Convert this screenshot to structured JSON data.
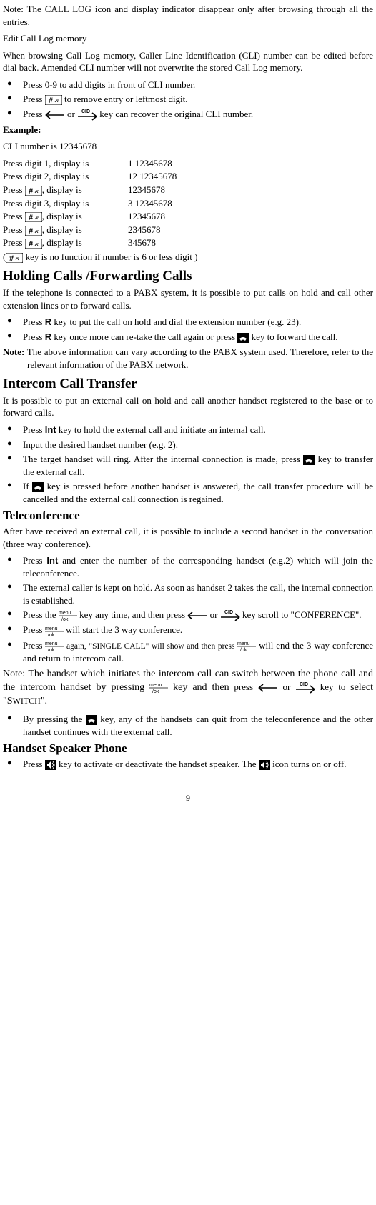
{
  "note1": "Note: The CALL LOG icon and display indicator disappear only after browsing through all the entries.",
  "editTitle": "Edit Call Log memory",
  "editPara": "When browsing Call Log memory, Caller Line Identification (CLI) number can be edited before dial back. Amended CLI number will not overwrite the stored Call Log memory.",
  "b1": "Press 0-9 to add digits in front of CLI number.",
  "b2a": "Press ",
  "b2b": " to remove entry or leftmost digit.",
  "b3a": "Press ",
  "b3b": " or ",
  "b3c": " key can recover the original CLI number.",
  "example": "Example:",
  "cliNum": "CLI number is 12345678",
  "rows": [
    {
      "l": "Press digit 1, display is",
      "r": "  1 12345678"
    },
    {
      "l": "Press digit 2, display is",
      "r": "  12 12345678"
    },
    {
      "l": "",
      "r": "   12345678"
    },
    {
      "l": "Press digit 3, display is",
      "r": "    3 12345678"
    },
    {
      "l": "",
      "r": "   12345678"
    },
    {
      "l": "",
      "r": "  2345678"
    },
    {
      "l": "",
      "r": "  345678"
    }
  ],
  "pressHash": "Press ",
  "pressHashTail": ",    display is",
  "paren1a": "(",
  "paren1b": " key is no function if number is 6 or less digit )",
  "h_holding": "Holding Calls /Forwarding Calls",
  "holdingP": "If the telephone is connected to a PABX system, it is possible to put calls on hold and call other extension lines or to forward calls.",
  "hold_b1a": "Press ",
  "hold_b1b": " key to put the call on hold and dial the extension number (e.g. 23).",
  "hold_b2a": " Press ",
  "hold_b2b": " key once more can re-take the call again or press ",
  "hold_b2c": " key to forward the call.",
  "hold_note": "Note:",
  "hold_note_body": " The above information can vary according to the PABX system used. Therefore, refer to the relevant information of the PABX network.",
  "h_intercom": "Intercom Call Transfer",
  "intercomP": "It is possible to put an external call on hold and call another handset registered to the base or to forward calls.",
  "ic_b1a": "Press ",
  "ic_b1b": " key to hold the external call and initiate an internal call.",
  "ic_b2": "Input the desired handset number (e.g. 2).",
  "ic_b3a": "The target handset will ring. After the internal connection is made, press ",
  "ic_b3b": " key to transfer the external call.",
  "ic_b4a": "If ",
  "ic_b4b": " key is pressed before another handset is answered, the call transfer procedure will be cancelled and the external call connection is regained.",
  "h_tele": "Teleconference",
  "teleP": "After have received an external call, it is possible to include a second handset in the conversation (three way conference).",
  "t_b1a": "Press ",
  "t_b1b": " and enter the number of the corresponding handset (e.g.2) which will join the teleconference.",
  "t_b2": "The external caller is kept on hold. As soon as handset 2 takes the call, the internal connection is established.",
  "t_b3a": "Press the ",
  "t_b3b": " key any time, and then press ",
  "t_b3c": " or ",
  "t_b3d": " key scroll to \"CONFERENCE\".",
  "t_b4a": "Press ",
  "t_b4b": " will start the 3 way conference.",
  "t_b5a": "Press ",
  "t_b5b": " again, \"SINGLE CALL\" will show and then press ",
  "t_b5c": " will end the 3 way conference and return to intercom call.",
  "note2a": "Note: The handset which initiates the intercom call can switch between the phone call and the intercom handset by pressing ",
  "note2b": " key and then",
  "note2c": " press ",
  "note2d": " or ",
  "note2e": " key to ",
  "note2f": "select \"S",
  "note2g": "WITCH",
  "note2h": "\".",
  "t_b6a": "By pressing the ",
  "t_b6b": " key, any of the handsets can quit from the teleconference and the other handset continues with the external call.",
  "h_speaker": "Handset Speaker Phone",
  "sp_b1a": "Press ",
  "sp_b1b": " key to activate or deactivate the handset speaker. The ",
  "sp_b1c": " icon turns on or off.",
  "keyR": "R",
  "keyInt": "Int",
  "pagenum": "– 9 –"
}
